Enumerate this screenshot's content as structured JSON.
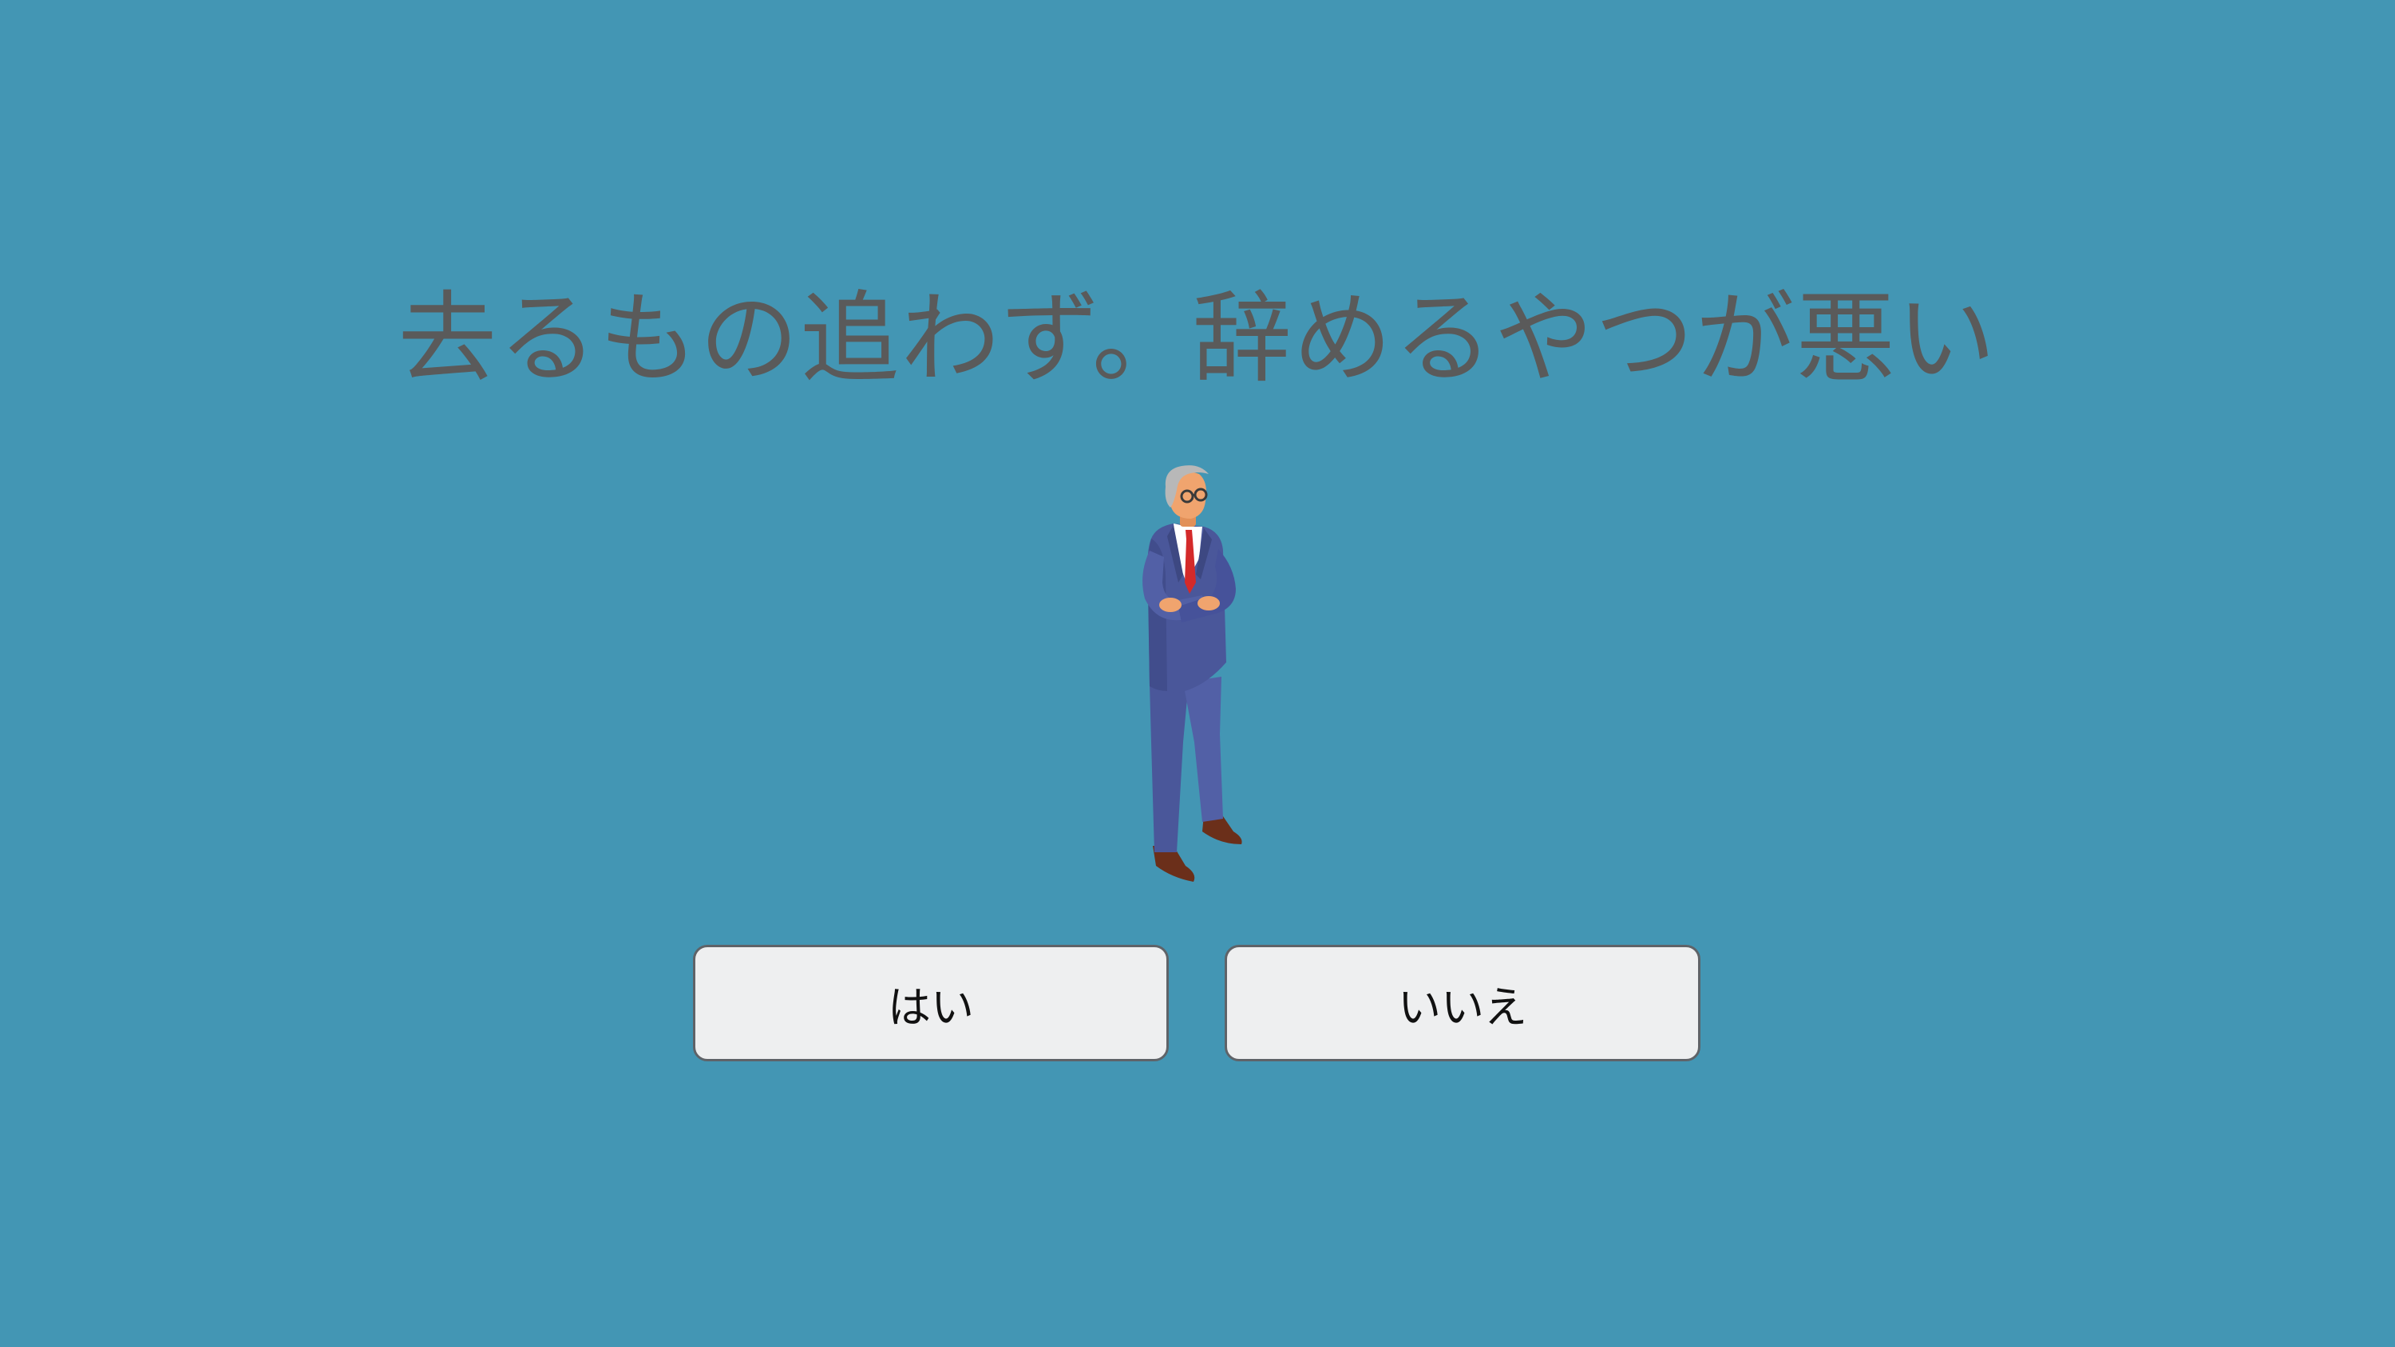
{
  "question": {
    "text": "去るもの追わず。辞めるやつが悪い"
  },
  "character": {
    "icon": "businessman-arms-crossed-icon"
  },
  "choices": {
    "yes_label": "はい",
    "no_label": "いいえ"
  },
  "colors": {
    "background": "#4396b4",
    "title_text": "#5a5a5a",
    "button_fill": "#eeeff0",
    "button_border": "#5f6368",
    "suit": "#4a579a",
    "tie": "#d42a2a",
    "skin": "#f0a46e",
    "hair": "#b8b8b8",
    "shoes": "#6b2f1a"
  }
}
